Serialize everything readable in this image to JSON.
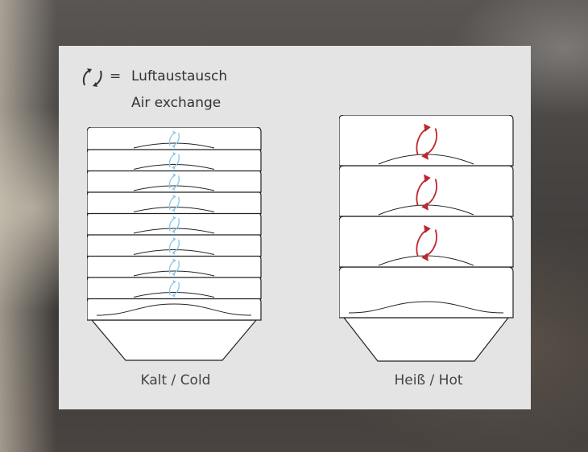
{
  "legend": {
    "icon": "air-exchange-arrows-icon",
    "equals": "=",
    "label_de": "Luftaustausch",
    "label_en": "Air exchange"
  },
  "stacks": [
    {
      "caption": "Kalt / Cold",
      "bowls": 9,
      "arrow_color": "#8ec8ea"
    },
    {
      "caption": "Heiß / Hot",
      "bowls": 4,
      "arrow_color": "#c0262e"
    }
  ]
}
